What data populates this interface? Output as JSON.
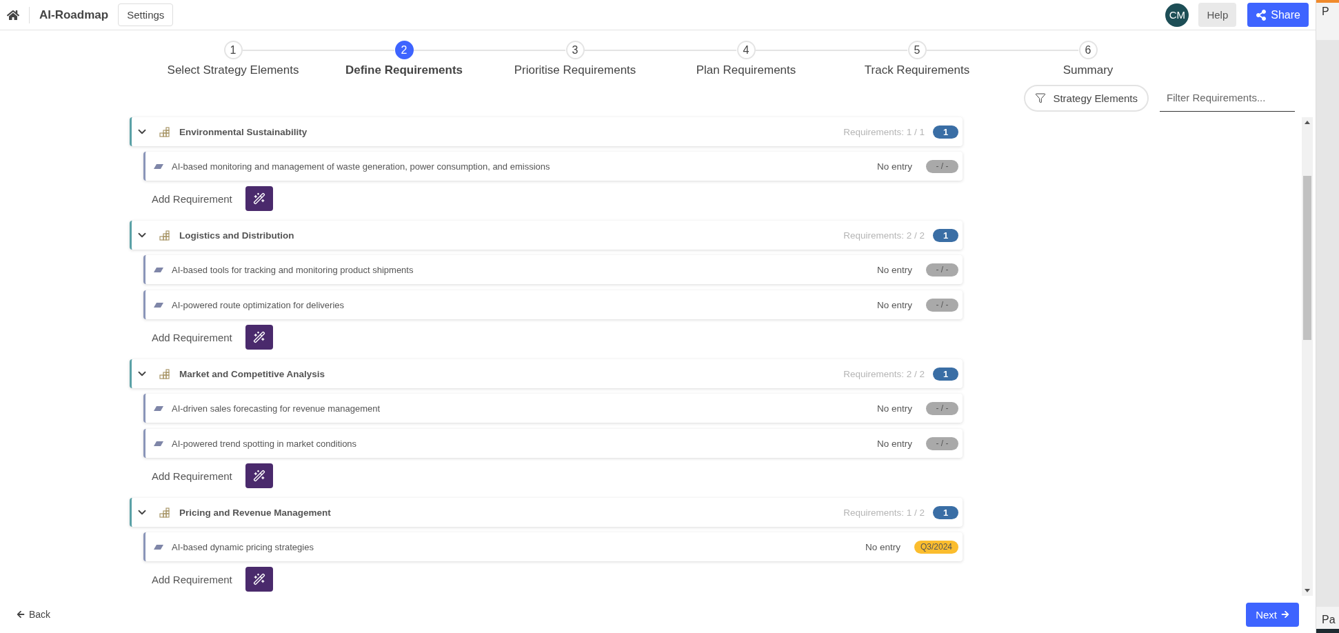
{
  "topbar": {
    "brand": "AI-Roadmap",
    "settings": "Settings",
    "avatar": "CM",
    "help": "Help",
    "share": "Share"
  },
  "steps": [
    {
      "number": "1",
      "label": "Select Strategy Elements",
      "selected": false
    },
    {
      "number": "2",
      "label": "Define Requirements",
      "selected": true
    },
    {
      "number": "3",
      "label": "Prioritise Requirements",
      "selected": false
    },
    {
      "number": "4",
      "label": "Plan Requirements",
      "selected": false
    },
    {
      "number": "5",
      "label": "Track Requirements",
      "selected": false
    },
    {
      "number": "6",
      "label": "Summary",
      "selected": false
    }
  ],
  "filter_bar": {
    "strategy_button": "Strategy Elements",
    "search": {
      "placeholder": "Filter Requirements..."
    }
  },
  "groups": [
    {
      "title": "Environmental Sustainability",
      "expanded": true,
      "count_text": "Requirements: 1 / 1",
      "badge": "1",
      "add_label": "Add Requirement",
      "items": [
        {
          "text": "AI-based monitoring and management of waste generation, power consumption, and emissions",
          "entry": "No entry",
          "status": "- / -",
          "color": "#a9a9a9"
        }
      ]
    },
    {
      "title": "Logistics and Distribution",
      "expanded": true,
      "count_text": "Requirements: 2 / 2",
      "badge": "1",
      "add_label": "Add Requirement",
      "items": [
        {
          "text": "AI-based tools for tracking and monitoring product shipments",
          "entry": "No entry",
          "status": "- / -",
          "color": "#a9a9a9"
        },
        {
          "text": "AI-powered route optimization for deliveries",
          "entry": "No entry",
          "status": "- / -",
          "color": "#a9a9a9"
        }
      ]
    },
    {
      "title": "Market and Competitive Analysis",
      "expanded": true,
      "count_text": "Requirements: 2 / 2",
      "badge": "1",
      "add_label": "Add Requirement",
      "items": [
        {
          "text": "AI-driven sales forecasting for revenue management",
          "entry": "No entry",
          "status": "- / -",
          "color": "#a9a9a9"
        },
        {
          "text": "AI-powered trend spotting in market conditions",
          "entry": "No entry",
          "status": "- / -",
          "color": "#a9a9a9"
        }
      ]
    },
    {
      "title": "Pricing and Revenue Management",
      "expanded": true,
      "count_text": "Requirements: 1 / 2",
      "badge": "1",
      "add_label": "Add Requirement",
      "items": [
        {
          "text": "AI-based dynamic pricing strategies",
          "entry": "No entry",
          "status": "Q3/2024",
          "color": "#fbbd2e"
        }
      ]
    }
  ],
  "footer": {
    "back": "Back",
    "next": "Next"
  },
  "side_window": {
    "top_text": "P",
    "bottom_text": "Pa"
  }
}
